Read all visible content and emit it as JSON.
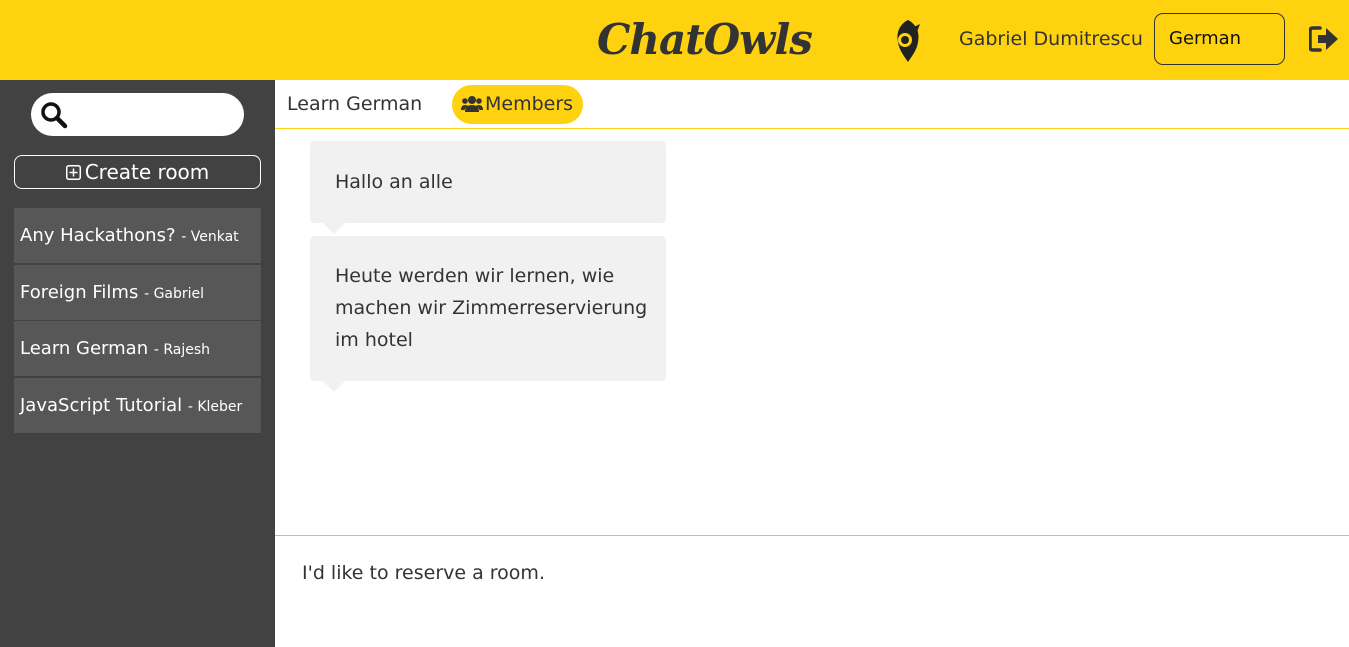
{
  "header": {
    "logo": "ChatOwls",
    "username": "Gabriel Dumitrescu",
    "language": "German"
  },
  "sidebar": {
    "search_placeholder": "",
    "create_room_label": "Create room",
    "rooms": [
      {
        "name": "Any Hackathons?",
        "owner": "- Venkat"
      },
      {
        "name": "Foreign Films",
        "owner": "- Gabriel"
      },
      {
        "name": "Learn German",
        "owner": "- Rajesh"
      },
      {
        "name": "JavaScript Tutorial",
        "owner": "- Kleber"
      }
    ]
  },
  "room": {
    "title": "Learn German",
    "members_label": "Members"
  },
  "messages": [
    {
      "text": "Hallo an alle"
    },
    {
      "text": "Heute werden wir lernen, wie machen wir Zimmerreservierung im hotel"
    }
  ],
  "composer": {
    "value": "I'd like to reserve a room."
  },
  "colors": {
    "brand_yellow": "#ffd20f",
    "sidebar_bg": "#424242",
    "room_item_bg": "#575757",
    "bubble_bg": "#f1f1f1"
  }
}
